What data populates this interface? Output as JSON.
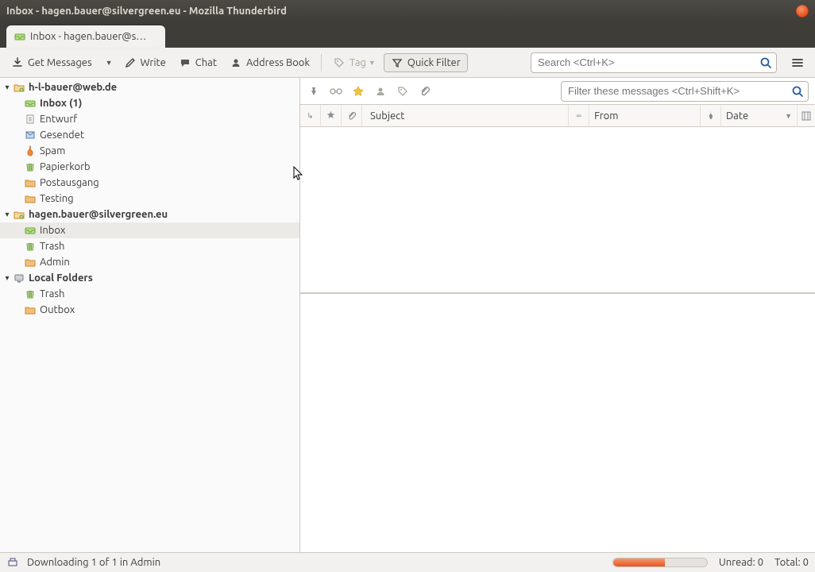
{
  "window": {
    "title": "Inbox - hagen.bauer@silvergreen.eu - Mozilla Thunderbird"
  },
  "tab": {
    "label": "Inbox - hagen.bauer@s…"
  },
  "toolbar": {
    "get_messages": "Get Messages",
    "write": "Write",
    "chat": "Chat",
    "address_book": "Address Book",
    "tag": "Tag",
    "quick_filter": "Quick Filter",
    "search_placeholder": "Search <Ctrl+K>"
  },
  "accounts": [
    {
      "name": "h-l-bauer@web.de",
      "folders": [
        {
          "label": "Inbox (1)",
          "bold": true,
          "icon": "inbox"
        },
        {
          "label": "Entwurf",
          "bold": false,
          "icon": "draft"
        },
        {
          "label": "Gesendet",
          "bold": false,
          "icon": "sent"
        },
        {
          "label": "Spam",
          "bold": false,
          "icon": "spam"
        },
        {
          "label": "Papierkorb",
          "bold": false,
          "icon": "trash"
        },
        {
          "label": "Postausgang",
          "bold": false,
          "icon": "folder"
        },
        {
          "label": "Testing",
          "bold": false,
          "icon": "folder"
        }
      ]
    },
    {
      "name": "hagen.bauer@silvergreen.eu",
      "folders": [
        {
          "label": "Inbox",
          "bold": false,
          "icon": "inbox",
          "selected": true
        },
        {
          "label": "Trash",
          "bold": false,
          "icon": "trash"
        },
        {
          "label": "Admin",
          "bold": false,
          "icon": "folder"
        }
      ]
    },
    {
      "name": "Local Folders",
      "folders": [
        {
          "label": "Trash",
          "bold": false,
          "icon": "trash"
        },
        {
          "label": "Outbox",
          "bold": false,
          "icon": "folder"
        }
      ]
    }
  ],
  "filterbar": {
    "placeholder": "Filter these messages <Ctrl+Shift+K>"
  },
  "columns": {
    "subject": "Subject",
    "from": "From",
    "date": "Date"
  },
  "status": {
    "message": "Downloading 1 of 1 in Admin",
    "unread_label": "Unread:",
    "unread_value": "0",
    "total_label": "Total:",
    "total_value": "0"
  },
  "icons": {
    "thread": "↳",
    "star": "★",
    "attach": "📎",
    "corr": "∞",
    "att2": "•"
  }
}
